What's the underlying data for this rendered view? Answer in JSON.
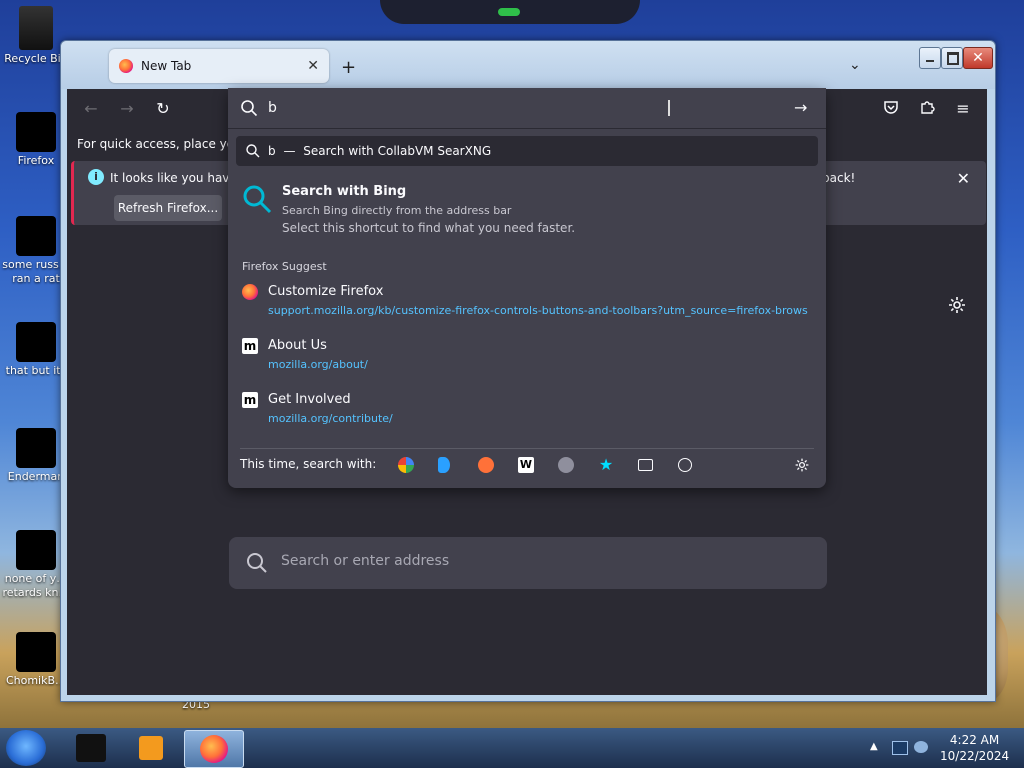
{
  "desktop": {
    "icons": [
      {
        "label": "Recycle Bin"
      },
      {
        "label": "Firefox"
      },
      {
        "label": "some russ… ran a rat"
      },
      {
        "label": "that but its"
      },
      {
        "label": "Enderman"
      },
      {
        "label": "none of y… retards kn…"
      },
      {
        "label": "ChomikB…"
      },
      {
        "label": "2015"
      }
    ]
  },
  "browser": {
    "tab_title": "New Tab",
    "new_tab_symbol": "+",
    "quick_access_text": "For quick access, place your b",
    "infobar": {
      "text_left": "It looks like you haven",
      "text_right": "back!",
      "button": "Refresh Firefox...",
      "close": "✕"
    },
    "urlbar": {
      "value": "b",
      "first_row_query": "b",
      "first_row_sep": "—",
      "first_row_text": "Search with CollabVM SearXNG",
      "bing_title": "Search with Bing",
      "bing_sub": "Search Bing directly from the address bar",
      "bing_hint": "Select this shortcut to find what you need faster.",
      "section": "Firefox Suggest",
      "suggestions": [
        {
          "title": "Customize Firefox",
          "url": "support.mozilla.org/kb/customize-firefox-controls-buttons-and-toolbars?utm_source=firefox-browser"
        },
        {
          "title": "About Us",
          "url": "mozilla.org/about/"
        },
        {
          "title": "Get Involved",
          "url": "mozilla.org/contribute/"
        }
      ],
      "search_with_label": "This time, search with:"
    },
    "big_search_placeholder": "Search or enter address"
  },
  "taskbar": {
    "time": "4:22 AM",
    "date": "10/22/2024"
  },
  "colors": {
    "content_bg": "#2b2a33",
    "panel_bg": "#42414d",
    "link_blue": "#55c3ff",
    "accent_red": "#e22850"
  }
}
